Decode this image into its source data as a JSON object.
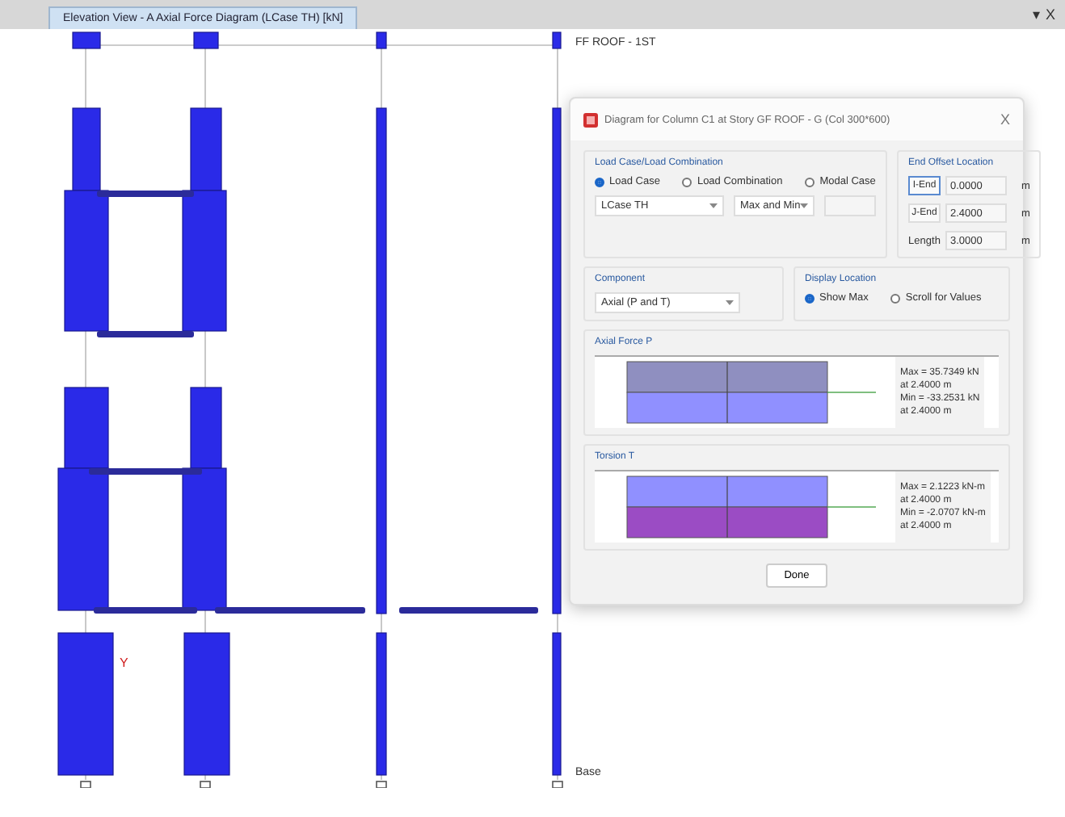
{
  "document_tab": {
    "title": "Elevation View - A  Axial Force Diagram  (LCase TH)  [kN]",
    "selected": true
  },
  "window_controls": [
    "▾",
    "X"
  ],
  "stories": [
    {
      "label": "FF ROOF - 1ST"
    },
    {
      "label": "Base"
    }
  ],
  "axis": {
    "label": "Y"
  },
  "dialog": {
    "title": "Diagram for Column C1 at Story GF ROOF - G (Col 300*600)",
    "close": "X",
    "load_group": {
      "title": "Load Case/Load Combination",
      "options": [
        {
          "label": "Load Case",
          "selected": true
        },
        {
          "label": "Load Combination",
          "selected": false
        },
        {
          "label": "Modal Case",
          "selected": false
        }
      ],
      "case": "LCase TH",
      "mode": "Max and Min"
    },
    "offset_group": {
      "title": "End Offset Location",
      "rows": [
        {
          "kind": "button",
          "label": "I-End",
          "value": "0.0000",
          "unit": "m",
          "selected": true
        },
        {
          "kind": "button",
          "label": "J-End",
          "value": "2.4000",
          "unit": "m",
          "selected": false
        },
        {
          "kind": "label",
          "label": "Length",
          "value": "3.0000",
          "unit": "m"
        }
      ]
    },
    "component": {
      "title": "Component",
      "value": "Axial (P and T)"
    },
    "display": {
      "title": "Display Location",
      "options": [
        {
          "label": "Show Max",
          "selected": true
        },
        {
          "label": "Scroll for Values",
          "selected": false
        }
      ]
    },
    "diagrams": [
      {
        "title": "Axial Force P",
        "readouts": [
          "Max = 35.7349 kN",
          "at 2.4000 m",
          "Min = -33.2531 kN",
          "at 2.4000 m"
        ],
        "bands": [
          {
            "color": "#8f8fc0"
          },
          {
            "color": "#9090ff"
          }
        ]
      },
      {
        "title": "Torsion T",
        "readouts": [
          "Max = 2.1223 kN-m",
          "at 2.4000 m",
          "Min = -2.0707 kN-m",
          "at 2.4000 m"
        ],
        "bands": [
          {
            "color": "#9090ff"
          },
          {
            "color": "#9b4cc4"
          }
        ]
      }
    ],
    "done": "Done"
  }
}
